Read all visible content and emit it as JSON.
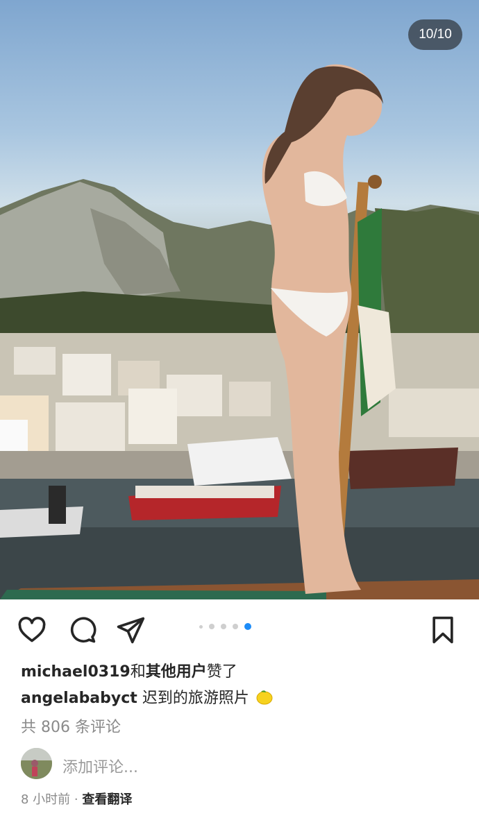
{
  "photo": {
    "counter": "10/10"
  },
  "actions": {
    "like_icon": "heart-icon",
    "comment_icon": "comment-bubble-icon",
    "share_icon": "paper-plane-icon",
    "save_icon": "bookmark-icon",
    "carousel_total_dots": 5,
    "carousel_active_index": 4,
    "accent_color": "#1d8cf8"
  },
  "likes": {
    "user": "michael0319",
    "connector": "和",
    "others": "其他用户",
    "suffix": "赞了"
  },
  "caption": {
    "author": "angelababyct",
    "text": "迟到的旅游照片",
    "emoji_icon": "lemon-icon"
  },
  "comments": {
    "count_text": "共 806 条评论"
  },
  "comment_box": {
    "placeholder": "添加评论..."
  },
  "meta": {
    "time": "8 小时前",
    "separator": "·",
    "translate": "查看翻译"
  }
}
